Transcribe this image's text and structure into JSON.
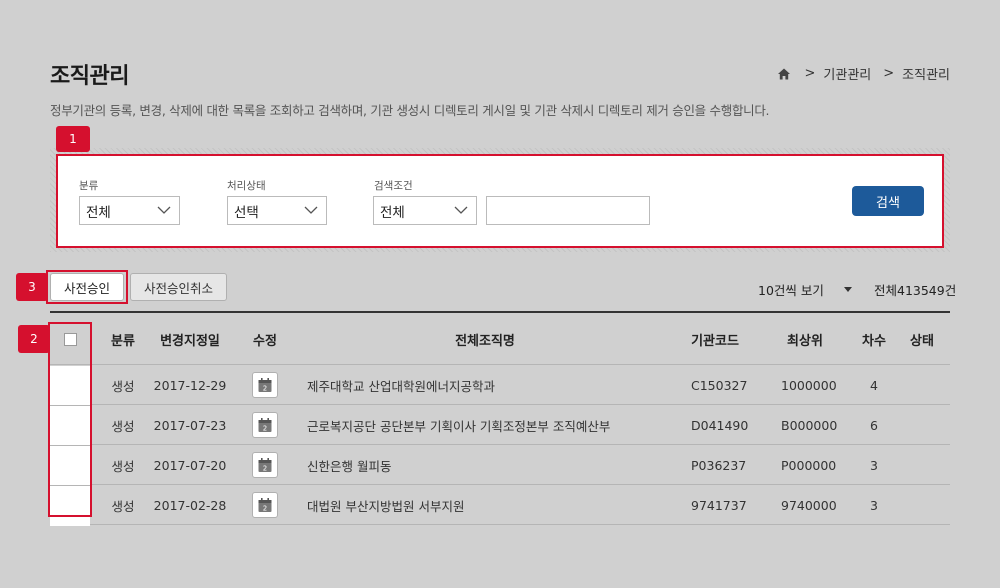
{
  "page": {
    "title": "조직관리",
    "description": "정부기관의 등록, 변경, 삭제에 대한 목록을 조회하고 검색하며, 기관 생성시 디렉토리 게시일 및 기관 삭제시 디렉토리 제거 승인을 수행합니다."
  },
  "breadcrumb": {
    "items": [
      ">",
      "기관관리",
      ">",
      "조직관리"
    ]
  },
  "search": {
    "badge": "1",
    "category_label": "분류",
    "category_value": "전체",
    "status_label": "처리상태",
    "status_value": "선택",
    "condition_label": "검색조건",
    "condition_value": "전체",
    "keyword_value": "",
    "search_button": "검색"
  },
  "actions": {
    "badge": "3",
    "pre_approve": "사전승인",
    "pre_approve_cancel": "사전승인취소",
    "per_page": "10건씩 보기",
    "total": "전체413549건"
  },
  "table": {
    "badge": "2",
    "headers": [
      "분류",
      "변경지정일",
      "수정",
      "전체조직명",
      "기관코드",
      "최상위",
      "차수",
      "상태"
    ],
    "rows": [
      {
        "category": "생성",
        "date": "2017-12-29",
        "cal_day": "2",
        "name": "제주대학교 산업대학원에너지공학과",
        "code": "C150327",
        "top": "1000000",
        "level": "4",
        "status": ""
      },
      {
        "category": "생성",
        "date": "2017-07-23",
        "cal_day": "2",
        "name": "근로복지공단 공단본부 기획이사 기획조정본부 조직예산부",
        "code": "D041490",
        "top": "B000000",
        "level": "6",
        "status": ""
      },
      {
        "category": "생성",
        "date": "2017-07-20",
        "cal_day": "2",
        "name": "신한은행 월피동",
        "code": "P036237",
        "top": "P000000",
        "level": "3",
        "status": ""
      },
      {
        "category": "생성",
        "date": "2017-02-28",
        "cal_day": "2",
        "name": "대법원 부산지방법원 서부지원",
        "code": "9741737",
        "top": "9740000",
        "level": "3",
        "status": ""
      }
    ]
  },
  "colors": {
    "highlight": "#d5102e",
    "primary_button": "#1d5a9a",
    "background": "#d0d0d0"
  }
}
